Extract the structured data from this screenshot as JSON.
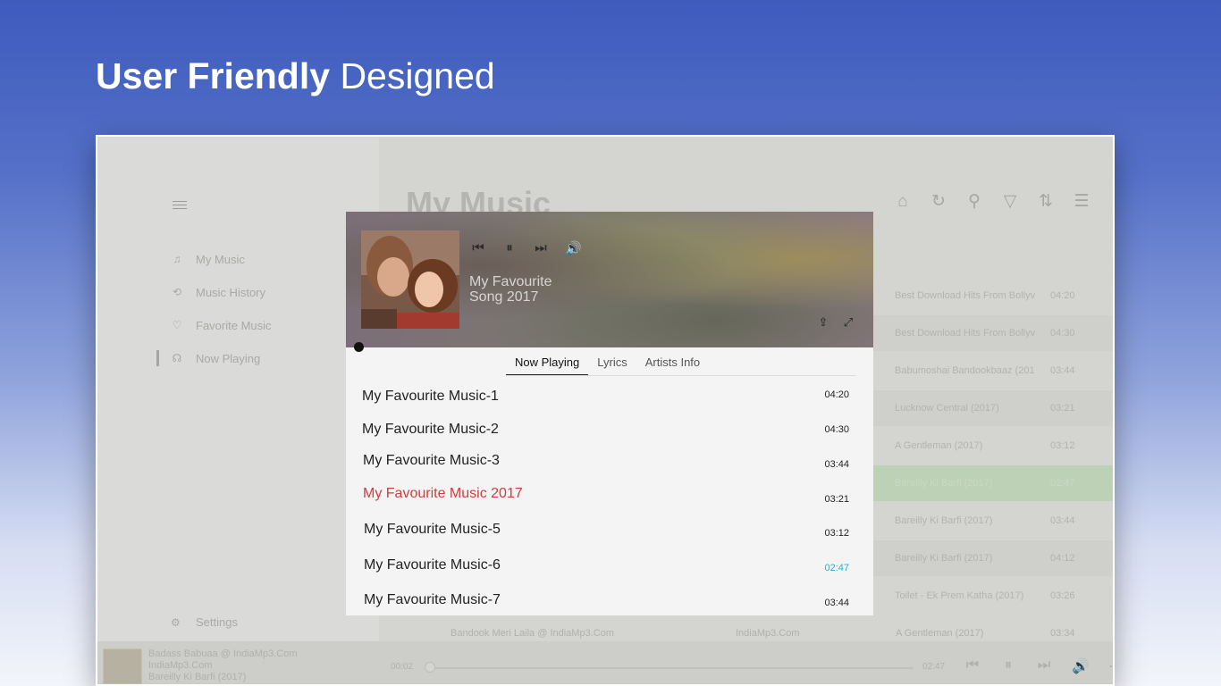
{
  "promo": {
    "title_bold": "User Friendly",
    "title_light": "Designed"
  },
  "sidebar": {
    "items": [
      {
        "label": "My Music",
        "icon": "music-note-icon"
      },
      {
        "label": "Music History",
        "icon": "history-icon"
      },
      {
        "label": "Favorite Music",
        "icon": "heart-icon"
      },
      {
        "label": "Now Playing",
        "icon": "headphones-icon"
      }
    ],
    "settings_label": "Settings"
  },
  "main": {
    "title": "My Music",
    "toolbar": [
      "home-icon",
      "refresh-icon",
      "search-icon",
      "filter-icon",
      "sort-icon",
      "list-icon"
    ],
    "rows": [
      {
        "album": "Best Download Hits From Bollyv",
        "time": "04:20"
      },
      {
        "album": "Best Download Hits From Bollyv",
        "time": "04:30"
      },
      {
        "album": "Babumoshai Bandookbaaz (201",
        "time": "03:44"
      },
      {
        "album": "Lucknow Central (2017)",
        "time": "03:21"
      },
      {
        "album": "A Gentleman (2017)",
        "time": "03:12"
      },
      {
        "album": "Bareilly Ki Barfi (2017)",
        "time": "02:47"
      },
      {
        "album": "Bareilly Ki Barfi (2017)",
        "time": "03:44"
      },
      {
        "album": "Bareilly Ki Barfi (2017)",
        "time": "04:12"
      },
      {
        "album": "Toilet - Ek Prem Katha (2017)",
        "time": "03:26"
      }
    ],
    "bottom_row": {
      "title": "Bandook Meri Laila @ IndiaMp3.Com",
      "artist": "IndiaMp3.Com",
      "album": "A Gentleman (2017)",
      "time": "03:34"
    }
  },
  "player_bar": {
    "track": "Badass Babuaa @ IndiaMp3.Com",
    "artist": "IndiaMp3.Com",
    "album": "Bareilly Ki Barfi (2017)",
    "elapsed": "00:02",
    "duration": "02:47"
  },
  "now_playing": {
    "song_line1": "My Favourite",
    "song_line2": "Song 2017",
    "tabs": [
      "Now Playing",
      "Lyrics",
      "Artists Info"
    ],
    "active_tab": "Now Playing",
    "tracks": [
      {
        "title": "My Favourite Music-1",
        "time": "04:20"
      },
      {
        "title": "My Favourite Music-2",
        "time": "04:30"
      },
      {
        "title": "My Favourite Music-3",
        "time": "03:44"
      },
      {
        "title": "My Favourite Music 2017",
        "time": "03:21"
      },
      {
        "title": "My Favourite Music-5",
        "time": "03:12"
      },
      {
        "title": "My Favourite Music-6",
        "time": "02:47"
      },
      {
        "title": "My Favourite Music-7",
        "time": "03:44"
      }
    ],
    "current_color": "#d23c3c",
    "accent_color": "#1cb4d8"
  }
}
